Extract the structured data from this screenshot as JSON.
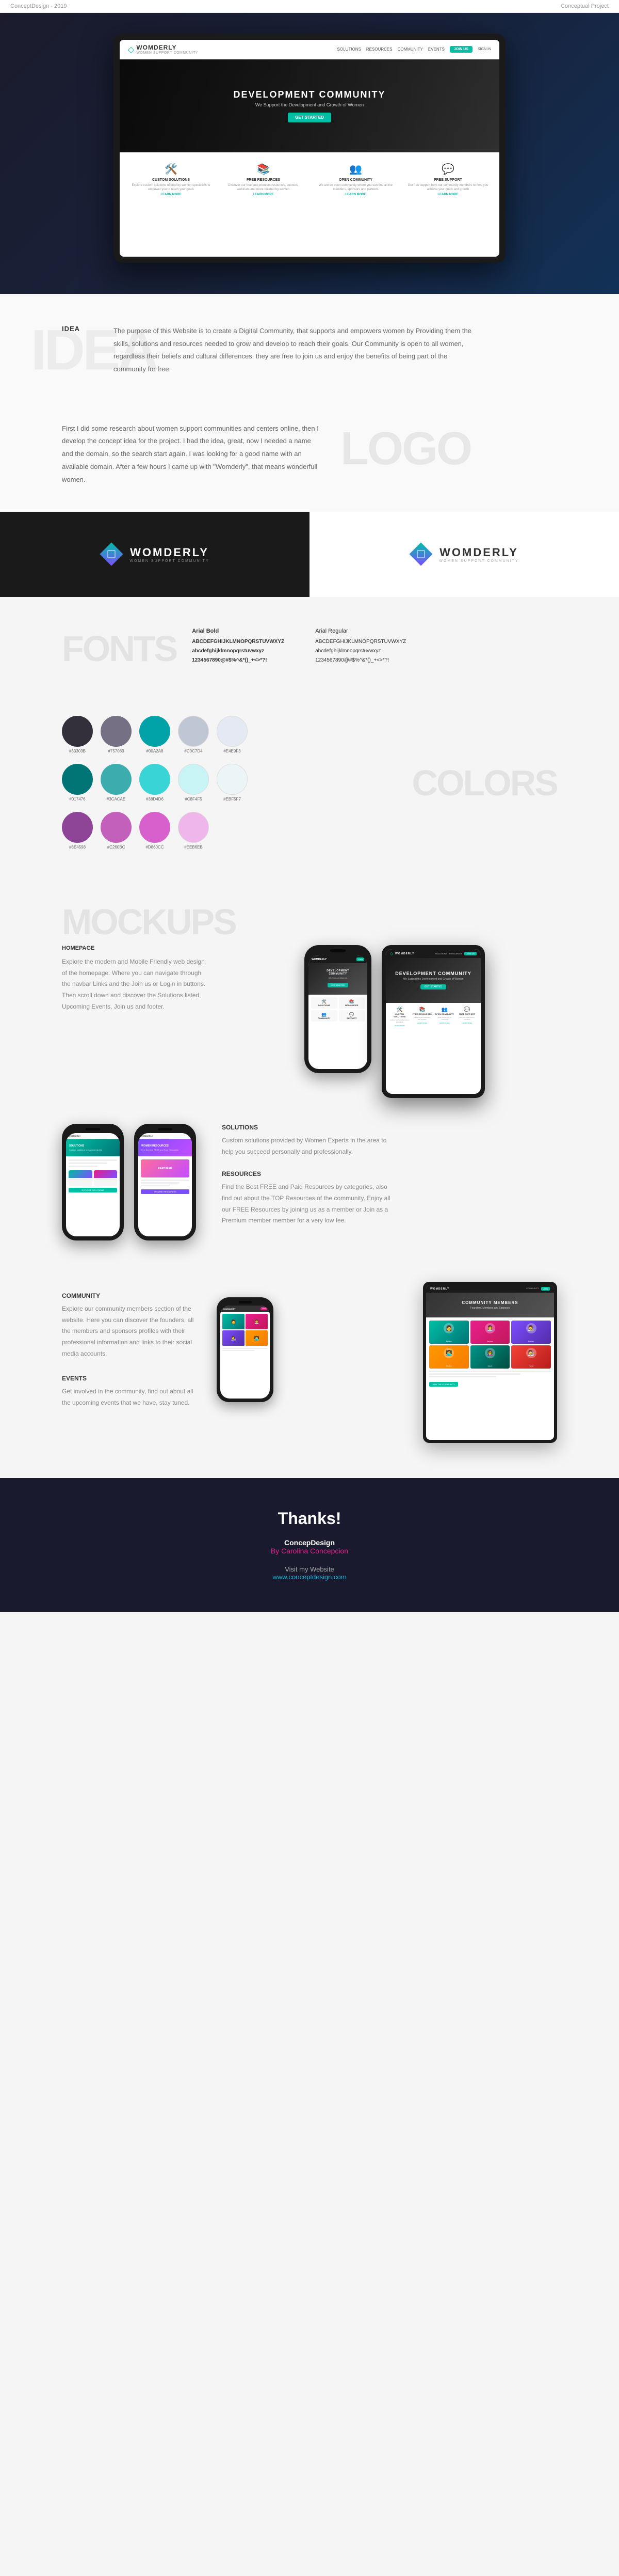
{
  "header": {
    "left": "ConceptDesign - 2019",
    "right": "Conceptual Project"
  },
  "site": {
    "name": "WOMDERLY",
    "tagline": "WOMEN SUPPORT COMMUNITY",
    "nav": {
      "links": [
        "SOLUTIONS",
        "RESOURCES",
        "COMMUNITY",
        "EVENTS"
      ],
      "join_btn": "JOIN US",
      "signin": "SIGN IN"
    },
    "hero": {
      "title": "DEVELOPMENT COMMUNITY",
      "subtitle": "We Support the Development and Growth of Women",
      "cta": "GET STARTED"
    },
    "features": [
      {
        "icon": "🛠️",
        "title": "CUSTOM SOLUTIONS",
        "text": "Explore custom solutions offered by women specialists to empower you to reach your goals",
        "link": "LEARN MORE"
      },
      {
        "icon": "📚",
        "title": "FREE RESOURCES",
        "text": "Discover our free and premium resources, courses, webinars and more created by women",
        "link": "LEARN MORE"
      },
      {
        "icon": "👥",
        "title": "OPEN COMMUNITY",
        "text": "We are an open community where you can find all the members, sponsors and partners",
        "link": "LEARN MORE"
      },
      {
        "icon": "💬",
        "title": "FREE SUPPORT",
        "text": "Get free support from our community members to help you achieve your goals and growth",
        "link": "LEARN MORE"
      }
    ]
  },
  "idea_section": {
    "bg_label": "IDEA",
    "label": "IDEA",
    "text": "The purpose of this Website is to create a Digital Community, that supports and empowers women by Providing them the skills, solutions and resources needed to grow and develop to reach their goals. Our Community is open to all women, regardless their beliefs and cultural differences, they are free to join us and enjoy the benefits of being part of the community for free."
  },
  "logo_section": {
    "bg_label": "LOGO",
    "label": "LOGO",
    "text": "First I did some research about women support communities and centers online, then I develop the concept idea for the project. I had the idea, great, now I needed a name and the domain, so the search start again. I was looking for a good name with an available domain. After a few hours I came up with \"Womderly\", that means wonderfull women.",
    "dark_version": "Dark Version",
    "light_version": "Light Version"
  },
  "fonts_section": {
    "bg_label": "FONTS",
    "label": "FONTS",
    "arial_bold": {
      "title": "Arial Bold",
      "uppercase": "ABCDEFGHIJKLMNOPQRSTUVWXYZ",
      "lowercase": "abcdefghijklmnopqrstuvwxyz",
      "numbers": "1234567890@#$%^&*()_+<>*?!"
    },
    "arial_regular": {
      "title": "Arial Regular",
      "uppercase": "ABCDEFGHIJKLMNOPQRSTUVWXYZ",
      "lowercase": "abcdefghijklmnopqrstuvwxyz",
      "numbers": "1234567890@#$%^&*()_+<>*?!"
    }
  },
  "colors_section": {
    "bg_label": "COLORS",
    "label": "COLORS",
    "swatches": [
      {
        "hex": "#33303B",
        "label": "#33303B"
      },
      {
        "hex": "#757083",
        "label": "#757083"
      },
      {
        "hex": "#00A2A8",
        "label": "#00A2A8"
      },
      {
        "hex": "#C0C7D4",
        "label": "#C0C7D4"
      },
      {
        "hex": "#E4E9F3",
        "label": "#E4E9F3"
      }
    ],
    "swatches2": [
      {
        "hex": "#017476",
        "label": "#017476"
      },
      {
        "hex": "#3CACAE",
        "label": "#3CACAE"
      },
      {
        "hex": "#38D4D6",
        "label": "#38D4D6"
      },
      {
        "hex": "#C8F4F5",
        "label": "#C8F4F5"
      },
      {
        "hex": "#EBF5F7",
        "label": "#EBF5F7"
      }
    ],
    "swatches3": [
      {
        "hex": "#8E4598",
        "label": "#8E4598"
      },
      {
        "hex": "#C260BC",
        "label": "#C260BC"
      },
      {
        "hex": "#D860CC",
        "label": "#D860CC"
      },
      {
        "hex": "#EEB6EB",
        "label": "#EEB6EB"
      }
    ]
  },
  "mockups_section": {
    "bg_label": "MOCKUPS",
    "label": "MOCKUPS",
    "homepage": {
      "title": "HOMEPAGE",
      "description": "Explore the modern and Mobile Friendly web design of the homepage. Where you can navigate through the navbar Links and the Join us or Login in buttons. Then scroll down and discover the Solutions listed, Upcoming Events, Join us and footer."
    },
    "solutions": {
      "title": "SOLUTIONS",
      "description": "Custom solutions provided by Women Experts in the area to help you succeed personally and professionally."
    },
    "resources": {
      "title": "RESOURCES",
      "description": "Find the Best FREE and Paid Resources by categories, also find out about the TOP Resources of the community. Enjoy all our FREE Resources by joining us as a member or Join as a Premium member member for a very low fee."
    }
  },
  "community_section": {
    "title": "COMMUNITY",
    "description": "Explore our community members section of the website. Here you can discover the founders, all the members and sponsors profiles with their professional information and links to their social media accounts."
  },
  "events_section": {
    "title": "EVENTS",
    "description": "Get involved in the community, find out about all the upcoming events that we have, stay tuned."
  },
  "thanks_section": {
    "title": "Thanks!",
    "company": "ConcepDesign",
    "author": "By Carolina Concepcion",
    "visit_label": "Visit my Website",
    "website": "www.conceptdesign.com"
  }
}
